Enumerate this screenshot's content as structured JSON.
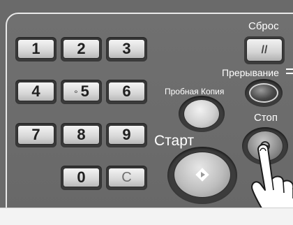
{
  "keypad": {
    "keys": [
      "1",
      "2",
      "3",
      "4",
      "5",
      "6",
      "7",
      "8",
      "9",
      "0",
      "C"
    ],
    "key5_dot": "∘"
  },
  "buttons": {
    "reset_label": "Сброс",
    "reset_icon_glyph": "//",
    "interrupt_label": "Прерывание",
    "proof_copy_label": "Пробная Копия",
    "stop_label": "Стоп",
    "start_label": "Старт"
  },
  "colors": {
    "panel": "#6a6a6a",
    "frame_line": "#e9e9e9",
    "key_face": "#d7d7d7",
    "label_text": "#ffffff"
  },
  "icons": {
    "start": "diamond-play-icon",
    "stop": "stop-icon",
    "reset": "reset-slash-icon",
    "interrupt": "interrupt-icon",
    "hand": "pointing-hand-icon"
  }
}
